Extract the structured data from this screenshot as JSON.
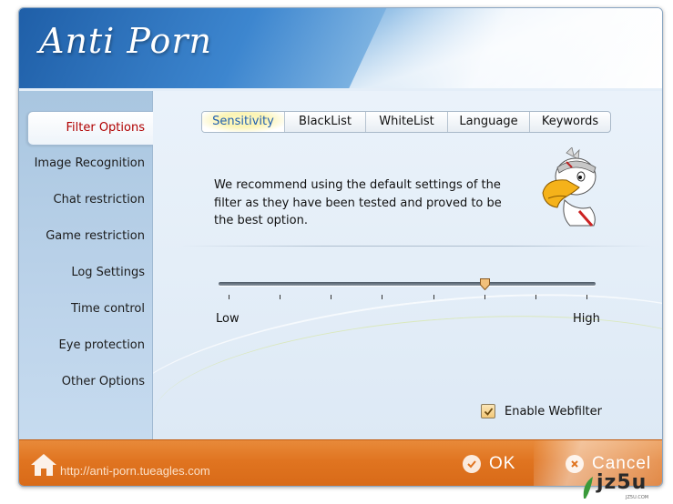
{
  "app": {
    "title": "Anti Porn"
  },
  "sidebar": {
    "active_index": 0,
    "items": [
      {
        "label": "Filter Options"
      },
      {
        "label": "Image Recognition"
      },
      {
        "label": "Chat restriction"
      },
      {
        "label": "Game restriction"
      },
      {
        "label": "Log Settings"
      },
      {
        "label": "Time control"
      },
      {
        "label": "Eye protection"
      },
      {
        "label": "Other Options"
      }
    ]
  },
  "tabs": {
    "active_index": 0,
    "items": [
      {
        "label": "Sensitivity"
      },
      {
        "label": "BlackList"
      },
      {
        "label": "WhiteList"
      },
      {
        "label": "Language"
      },
      {
        "label": "Keywords"
      }
    ]
  },
  "sensitivity": {
    "description": "We recommend using the default settings of the filter as they have been tested and proved to be the best option.",
    "slider": {
      "min_label": "Low",
      "max_label": "High",
      "steps": 8,
      "value": 5
    }
  },
  "webfilter": {
    "label": "Enable Webfilter",
    "checked": true
  },
  "footer": {
    "url": "http://anti-porn.tueagles.com",
    "ok_label": "OK",
    "cancel_label": "Cancel"
  },
  "watermark": {
    "text": "jz5u",
    "sub": "JZ5U.COM"
  },
  "colors": {
    "header": "#3d86cf",
    "footer": "#e07420",
    "active_item": "#b00000",
    "active_tab": "#1f5fb0"
  },
  "icons": {
    "home": "home-icon",
    "ok": "check-circle-icon",
    "cancel": "x-circle-icon",
    "mascot": "eagle-mascot-icon"
  }
}
